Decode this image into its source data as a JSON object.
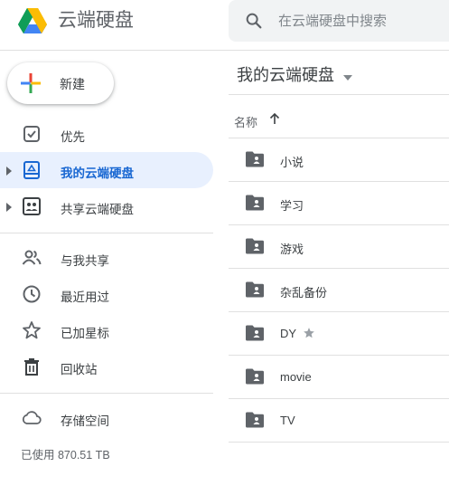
{
  "header": {
    "app_title": "云端硬盘",
    "search_placeholder": "在云端硬盘中搜索"
  },
  "new_button": {
    "label": "新建"
  },
  "sidebar": {
    "items": [
      {
        "label": "优先",
        "icon": "priority-check-icon"
      },
      {
        "label": "我的云端硬盘",
        "icon": "my-drive-icon",
        "active": true
      },
      {
        "label": "共享云端硬盘",
        "icon": "shared-drives-icon"
      },
      {
        "label": "与我共享",
        "icon": "shared-with-me-icon"
      },
      {
        "label": "最近用过",
        "icon": "clock-icon"
      },
      {
        "label": "已加星标",
        "icon": "star-outline-icon"
      },
      {
        "label": "回收站",
        "icon": "trash-icon"
      },
      {
        "label": "存储空间",
        "icon": "cloud-icon"
      }
    ],
    "storage_used": "已使用 870.51 TB"
  },
  "main": {
    "breadcrumb": "我的云端硬盘",
    "column_name": "名称",
    "files": [
      {
        "name": "小说"
      },
      {
        "name": "学习"
      },
      {
        "name": "游戏"
      },
      {
        "name": "杂乱备份"
      },
      {
        "name": "DY",
        "starred": true
      },
      {
        "name": "movie"
      },
      {
        "name": "TV"
      }
    ]
  },
  "colors": {
    "active_bg": "#e8f0fe",
    "active_text": "#1967d2",
    "icon_gray": "#5f6368",
    "folder_gray": "#5f6368",
    "divider": "#e0e0e0"
  }
}
